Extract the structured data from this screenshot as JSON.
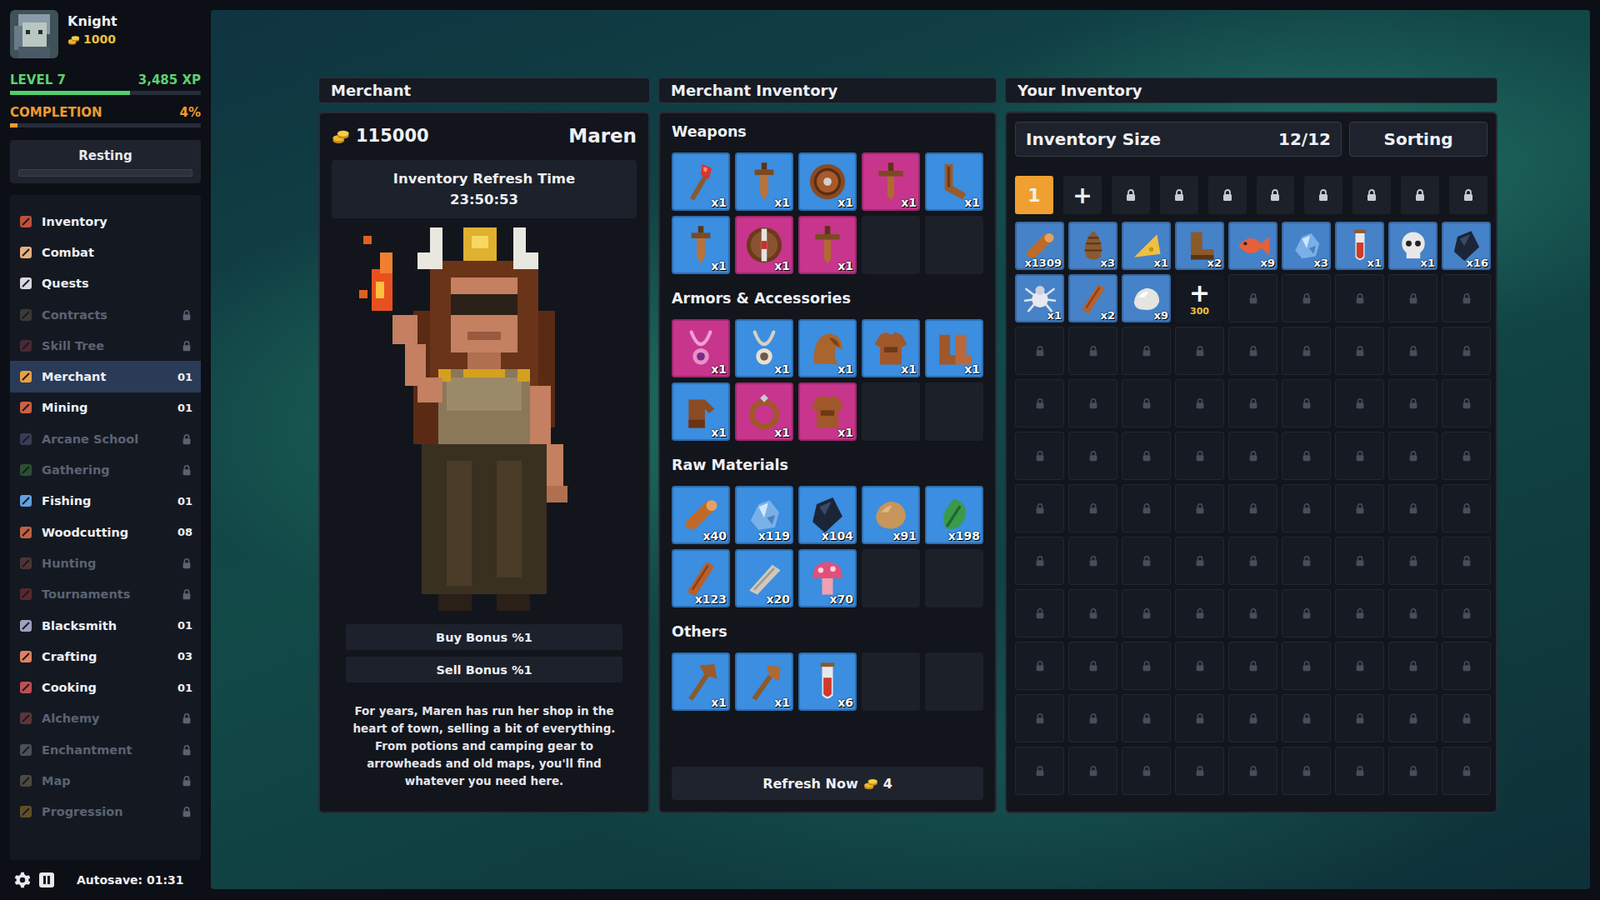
{
  "player": {
    "name": "Knight",
    "gold": "1000",
    "level_label": "LEVEL 7",
    "xp": "3,485 XP",
    "xp_level": 0.63,
    "completion_label": "COMPLETION",
    "completion": "4%",
    "completion_level": 0.04,
    "status": "Resting",
    "status_level": 0
  },
  "sidebar": {
    "items": [
      {
        "label": "Inventory",
        "count": null,
        "locked": false,
        "selected": false,
        "color": "#c0503a"
      },
      {
        "label": "Combat",
        "count": null,
        "locked": false,
        "selected": false,
        "color": "#e8b080"
      },
      {
        "label": "Quests",
        "count": null,
        "locked": false,
        "selected": false,
        "color": "#d8d8e0"
      },
      {
        "label": "Contracts",
        "count": null,
        "locked": true,
        "selected": false,
        "color": "#7a6a5a"
      },
      {
        "label": "Skill Tree",
        "count": null,
        "locked": true,
        "selected": false,
        "color": "#a04050"
      },
      {
        "label": "Merchant",
        "count": "01",
        "locked": false,
        "selected": true,
        "color": "#e8a040"
      },
      {
        "label": "Mining",
        "count": "01",
        "locked": false,
        "selected": false,
        "color": "#d06040"
      },
      {
        "label": "Arcane School",
        "count": null,
        "locked": true,
        "selected": false,
        "color": "#7070a0"
      },
      {
        "label": "Gathering",
        "count": null,
        "locked": true,
        "selected": false,
        "color": "#50a050"
      },
      {
        "label": "Fishing",
        "count": "01",
        "locked": false,
        "selected": false,
        "color": "#60a0e0"
      },
      {
        "label": "Woodcutting",
        "count": "08",
        "locked": false,
        "selected": false,
        "color": "#c06040"
      },
      {
        "label": "Hunting",
        "count": null,
        "locked": true,
        "selected": false,
        "color": "#a06050"
      },
      {
        "label": "Tournaments",
        "count": null,
        "locked": true,
        "selected": false,
        "color": "#c04040"
      },
      {
        "label": "Blacksmith",
        "count": "01",
        "locked": false,
        "selected": false,
        "color": "#a0a0c0"
      },
      {
        "label": "Crafting",
        "count": "03",
        "locked": false,
        "selected": false,
        "color": "#e08060"
      },
      {
        "label": "Cooking",
        "count": "01",
        "locked": false,
        "selected": false,
        "color": "#c05050"
      },
      {
        "label": "Alchemy",
        "count": null,
        "locked": true,
        "selected": false,
        "color": "#d06060"
      },
      {
        "label": "Enchantment",
        "count": null,
        "locked": true,
        "selected": false,
        "color": "#a0a0a0"
      },
      {
        "label": "Map",
        "count": null,
        "locked": true,
        "selected": false,
        "color": "#a09070"
      },
      {
        "label": "Progression",
        "count": null,
        "locked": true,
        "selected": false,
        "color": "#d0a030"
      }
    ],
    "autosave": "Autosave: 01:31"
  },
  "merchant": {
    "title": "Merchant",
    "gold": "115000",
    "name": "Maren",
    "refresh_label": "Inventory Refresh Time",
    "refresh_time": "23:50:53",
    "buy_bonus": "Buy Bonus %1",
    "sell_bonus": "Sell Bonus %1",
    "description": "For years, Maren has run her shop in the heart of town, selling a bit of everything. From potions and camping gear to arrowheads and old maps, you'll find whatever you need here."
  },
  "merchant_inventory": {
    "title": "Merchant Inventory",
    "sections": [
      {
        "title": "Weapons",
        "empty_slots": 2,
        "items": [
          {
            "kind": "wand",
            "count": "x1",
            "color": "#3b8ee0"
          },
          {
            "kind": "dagger",
            "count": "x1",
            "color": "#3b8ee0"
          },
          {
            "kind": "shield",
            "count": "x1",
            "color": "#3b8ee0"
          },
          {
            "kind": "sword",
            "count": "x1",
            "color": "#c8358c"
          },
          {
            "kind": "crossbow",
            "count": "x1",
            "color": "#3b8ee0"
          },
          {
            "kind": "dagger",
            "count": "x1",
            "color": "#3b8ee0"
          },
          {
            "kind": "shield2",
            "count": "x1",
            "color": "#c8358c"
          },
          {
            "kind": "sword",
            "count": "x1",
            "color": "#c8358c"
          }
        ]
      },
      {
        "title": "Armors & Accessories",
        "empty_slots": 2,
        "items": [
          {
            "kind": "amulet",
            "count": "x1",
            "color": "#c8358c"
          },
          {
            "kind": "amulet2",
            "count": "x1",
            "color": "#3b8ee0"
          },
          {
            "kind": "hood",
            "count": "x1",
            "color": "#3b8ee0"
          },
          {
            "kind": "chest",
            "count": "x1",
            "color": "#3b8ee0"
          },
          {
            "kind": "boots",
            "count": "x1",
            "color": "#3b8ee0"
          },
          {
            "kind": "gloves",
            "count": "x1",
            "color": "#3b8ee0"
          },
          {
            "kind": "ring",
            "count": "x1",
            "color": "#c8358c"
          },
          {
            "kind": "chest",
            "count": "x1",
            "color": "#c8358c"
          }
        ]
      },
      {
        "title": "Raw Materials",
        "empty_slots": 2,
        "items": [
          {
            "kind": "log",
            "count": "x40",
            "color": "#3b8ee0"
          },
          {
            "kind": "ore",
            "count": "x119",
            "color": "#3b8ee0"
          },
          {
            "kind": "coal",
            "count": "x104",
            "color": "#3b8ee0"
          },
          {
            "kind": "stone",
            "count": "x91",
            "color": "#3b8ee0"
          },
          {
            "kind": "herb",
            "count": "x198",
            "color": "#3b8ee0"
          },
          {
            "kind": "plank",
            "count": "x123",
            "color": "#3b8ee0"
          },
          {
            "kind": "slab",
            "count": "x20",
            "color": "#3b8ee0"
          },
          {
            "kind": "mushroom",
            "count": "x70",
            "color": "#3b8ee0"
          }
        ]
      },
      {
        "title": "Others",
        "empty_slots": 2,
        "items": [
          {
            "kind": "axe",
            "count": "x1",
            "color": "#3b8ee0"
          },
          {
            "kind": "shovel",
            "count": "x1",
            "color": "#3b8ee0"
          },
          {
            "kind": "potion",
            "count": "x6",
            "color": "#3b8ee0"
          }
        ]
      }
    ],
    "refresh_button": {
      "label": "Refresh Now",
      "cost": "4"
    }
  },
  "your_inventory": {
    "title": "Your Inventory",
    "size_label": "Inventory Size",
    "size": "12/12",
    "sorting": "Sorting",
    "pages": [
      {
        "label": "1",
        "selected": true
      }
    ],
    "add_page": "+",
    "locked_pages": 8,
    "items": [
      {
        "kind": "log",
        "count": "x1309",
        "color": "#4682c8"
      },
      {
        "kind": "pinecone",
        "count": "x3",
        "color": "#4682c8"
      },
      {
        "kind": "cheese",
        "count": "x1",
        "color": "#4682c8"
      },
      {
        "kind": "boot",
        "count": "x2",
        "color": "#4682c8"
      },
      {
        "kind": "fish",
        "count": "x9",
        "color": "#4682c8"
      },
      {
        "kind": "ore",
        "count": "x3",
        "color": "#4682c8"
      },
      {
        "kind": "potion",
        "count": "x1",
        "color": "#4682c8"
      },
      {
        "kind": "skull",
        "count": "x1",
        "color": "#4682c8"
      },
      {
        "kind": "coal",
        "count": "x16",
        "color": "#4682c8"
      },
      {
        "kind": "spider",
        "count": "x1",
        "color": "#4682c8"
      },
      {
        "kind": "plank",
        "count": "x2",
        "color": "#4682c8"
      },
      {
        "kind": "rock",
        "count": "x9",
        "color": "#4682c8"
      }
    ],
    "buy_slot": {
      "label": "+",
      "price": "300"
    },
    "locked_slots": 86
  }
}
